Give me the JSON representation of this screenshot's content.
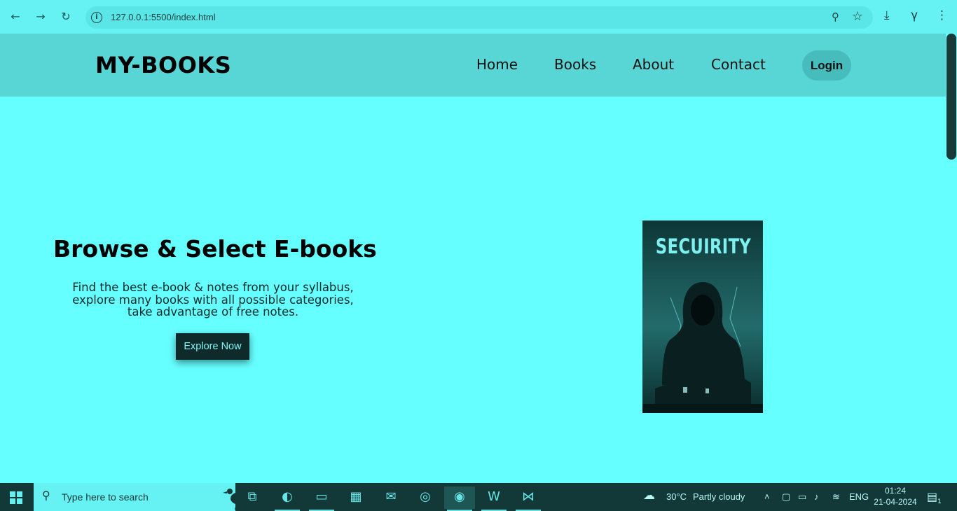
{
  "browser": {
    "back": "←",
    "forward": "→",
    "reload": "↻",
    "url": "127.0.0.1:5500/index.html",
    "info_icon": "i",
    "zoom_icon": "⚲",
    "star_icon": "☆",
    "download_icon": "⤓",
    "ext_icon": "γ",
    "menu_icon": "⋮"
  },
  "site": {
    "logo": "MY-BOOKS",
    "nav": [
      "Home",
      "Books",
      "About",
      "Contact"
    ],
    "login": "Login"
  },
  "hero": {
    "title": "Browse & Select E-books",
    "description": "Find the best e-book & notes from your syllabus, explore many books with all possible categories, take advantage of free notes.",
    "cta": "Explore Now",
    "book_title": "SECUIRITY"
  },
  "taskbar": {
    "search_placeholder": "Type here to search",
    "weather_temp": "30°C",
    "weather_text": "Partly cloudy",
    "lang": "ENG",
    "time": "01:24",
    "date": "21-04-2024",
    "notif_count": "1"
  },
  "colors": {
    "page_bg": "#66ffff",
    "header_bg": "#58d6d6",
    "button_bg": "#0f2a2a",
    "taskbar_bg": "#123838"
  }
}
